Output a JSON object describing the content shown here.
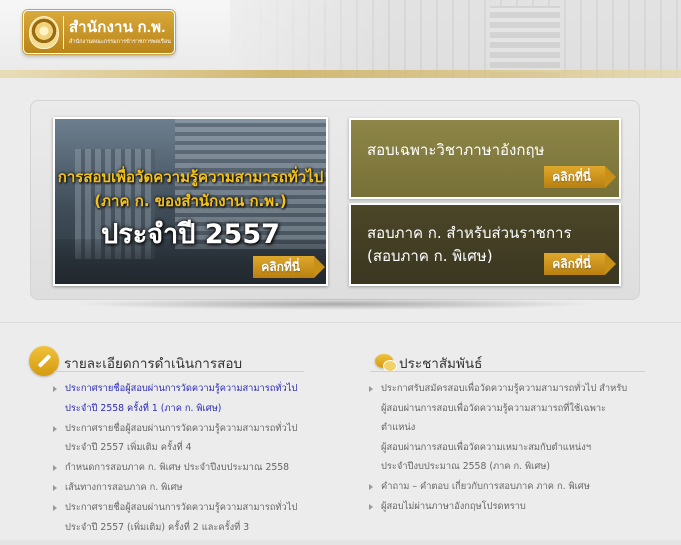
{
  "header": {
    "logo_title": "สำนักงาน ก.พ.",
    "logo_subtitle": "สำนักงานคณะกรรมการข้าราชการพลเรือน"
  },
  "banner": {
    "promo": {
      "line1": "การสอบเพื่อวัดความรู้ความสามารถทั่วไป",
      "line2": "(ภาค ก. ของสำนักงาน ก.พ.)",
      "line3": "ประจำปี 2557",
      "click_label": "คลิกที่นี่"
    },
    "english_box": {
      "title": "สอบเฉพาะวิชาภาษาอังกฤษ",
      "click_label": "คลิกที่นี่"
    },
    "gov_box": {
      "title_line1": "สอบภาค ก. สำหรับส่วนราชการ",
      "title_line2": "(สอบภาค ก. พิเศษ)",
      "click_label": "คลิกที่นี่"
    }
  },
  "left_section": {
    "title": "รายละเอียดการดำเนินการสอบ",
    "items": [
      {
        "line1": "ประกาศรายชื่อผู้สอบผ่านการวัดความรู้ความสามารถทั่วไป",
        "line2": "ประจำปี 2558 ครั้งที่ 1 (ภาค ก. พิเศษ)"
      },
      {
        "line1": "ประกาศรายชื่อผู้สอบผ่านการวัดความรู้ความสามารถทั่วไป",
        "line2": "ประจำปี 2557 เพิ่มเติม ครั้งที่ 4"
      },
      {
        "line1": "กำหนดการสอบภาค ก. พิเศษ ประจำปีงบประมาณ 2558",
        "line2": ""
      },
      {
        "line1": "เส้นทางการสอบภาค ก. พิเศษ",
        "line2": ""
      },
      {
        "line1": "ประกาศรายชื่อผู้สอบผ่านการวัดความรู้ความสามารถทั่วไป",
        "line2": "ประจำปี 2557 (เพิ่มเติม) ครั้งที่ 2 และครั้งที่ 3"
      }
    ]
  },
  "right_section": {
    "title": "ประชาสัมพันธ์",
    "items": [
      {
        "line1": "ประกาศรับสมัครสอบเพื่อวัดความรู้ความสามารถทั่วไป สำหรับ",
        "line2": "ผู้สอบผ่านการสอบเพื่อวัดความรู้ความสามารถที่ใช้เฉพาะตำแหน่ง",
        "line3": "ผู้สอบผ่านการสอบเพื่อวัดความเหมาะสมกับตำแหน่งฯ",
        "line4": "ประจำปีงบประมาณ 2558 (ภาค ก. พิเศษ)"
      },
      {
        "line1": "คำถาม – คำตอบ เกี่ยวกับการสอบภาค ภาค ก. พิเศษ"
      },
      {
        "line1": "ผู้สอบไม่ผ่านภาษาอังกฤษโปรดทราบ"
      }
    ]
  }
}
